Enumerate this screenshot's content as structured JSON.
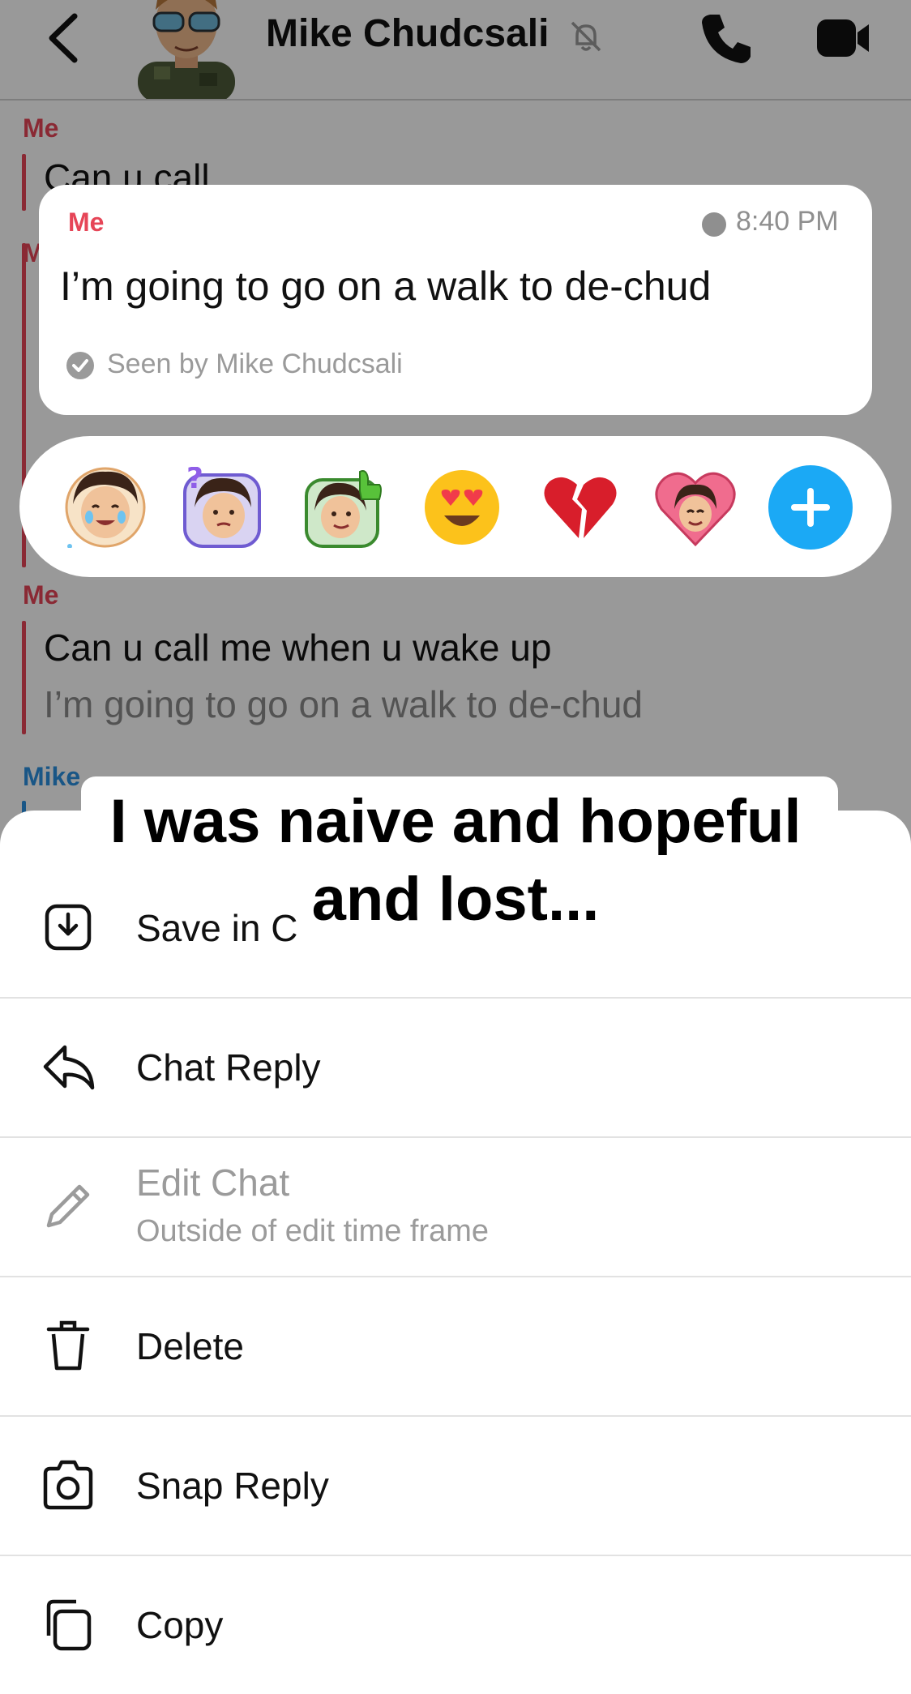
{
  "header": {
    "title": "Mike Chudcsali"
  },
  "chat": {
    "messages": [
      {
        "sender": "Me",
        "text": "Can u call"
      },
      {
        "sender": "M"
      },
      {
        "sender": "Me",
        "text": "Can u call me when u wake up",
        "quote": "I’m going to go on a walk to de-chud"
      },
      {
        "sender": "Mike"
      }
    ]
  },
  "focused_message": {
    "sender": "Me",
    "time": "8:40 PM",
    "text": "I’m going to go on a walk to de-chud",
    "seen": "Seen by Mike Chudcsali"
  },
  "reactions": [
    {
      "icon": "bitmoji-crying-laughing-icon"
    },
    {
      "icon": "bitmoji-confused-icon"
    },
    {
      "icon": "bitmoji-thumbs-up-icon"
    },
    {
      "icon": "heart-eyes-emoji-icon"
    },
    {
      "icon": "broken-heart-emoji-icon"
    },
    {
      "icon": "bitmoji-heart-icon"
    },
    {
      "icon": "plus-icon"
    }
  ],
  "menu": {
    "items": [
      {
        "label": "Save in C",
        "icon": "save-icon"
      },
      {
        "label": "Chat Reply",
        "icon": "reply-icon"
      },
      {
        "label": "Edit Chat",
        "sub": "Outside of edit time frame",
        "icon": "pencil-icon"
      },
      {
        "label": "Delete",
        "icon": "trash-icon"
      },
      {
        "label": "Snap Reply",
        "icon": "camera-icon"
      },
      {
        "label": "Copy",
        "icon": "copy-icon"
      }
    ]
  },
  "caption": {
    "line1": "I was naive and hopeful",
    "line2": "and lost..."
  },
  "colors": {
    "me": "#e64557",
    "mike": "#2b8fe0",
    "accent": "#1ba9f5"
  }
}
